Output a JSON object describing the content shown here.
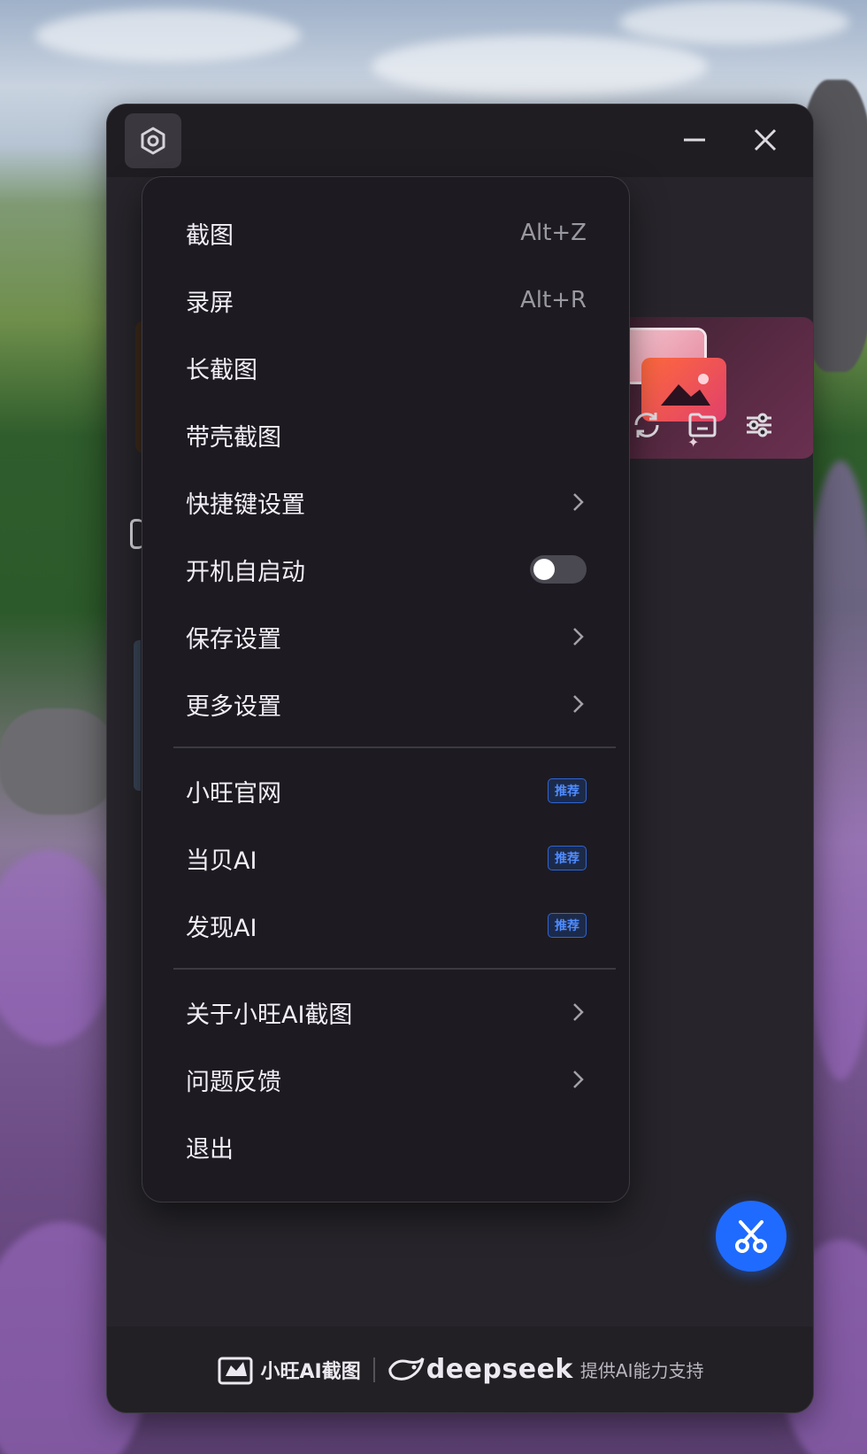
{
  "menu": {
    "section1": [
      {
        "label": "截图",
        "shortcut": "Alt+Z"
      },
      {
        "label": "录屏",
        "shortcut": "Alt+R"
      },
      {
        "label": "长截图"
      },
      {
        "label": "带壳截图"
      },
      {
        "label": "快捷键设置",
        "submenu": true
      },
      {
        "label": "开机自启动",
        "toggle": false
      },
      {
        "label": "保存设置",
        "submenu": true
      },
      {
        "label": "更多设置",
        "submenu": true
      }
    ],
    "section2": [
      {
        "label": "小旺官网",
        "badge": "推荐"
      },
      {
        "label": "当贝AI",
        "badge": "推荐"
      },
      {
        "label": "发现AI",
        "badge": "推荐"
      }
    ],
    "section3": [
      {
        "label": "关于小旺AI截图",
        "submenu": true
      },
      {
        "label": "问题反馈",
        "submenu": true
      },
      {
        "label": "退出"
      }
    ]
  },
  "footer": {
    "app_name": "小旺AI截图",
    "partner": "deepseek",
    "tagline": "提供AI能力支持"
  },
  "colors": {
    "window_bg": "#27252b",
    "menu_bg": "#1d1b21",
    "accent": "#1f6bff",
    "badge": "#4f8cff"
  }
}
